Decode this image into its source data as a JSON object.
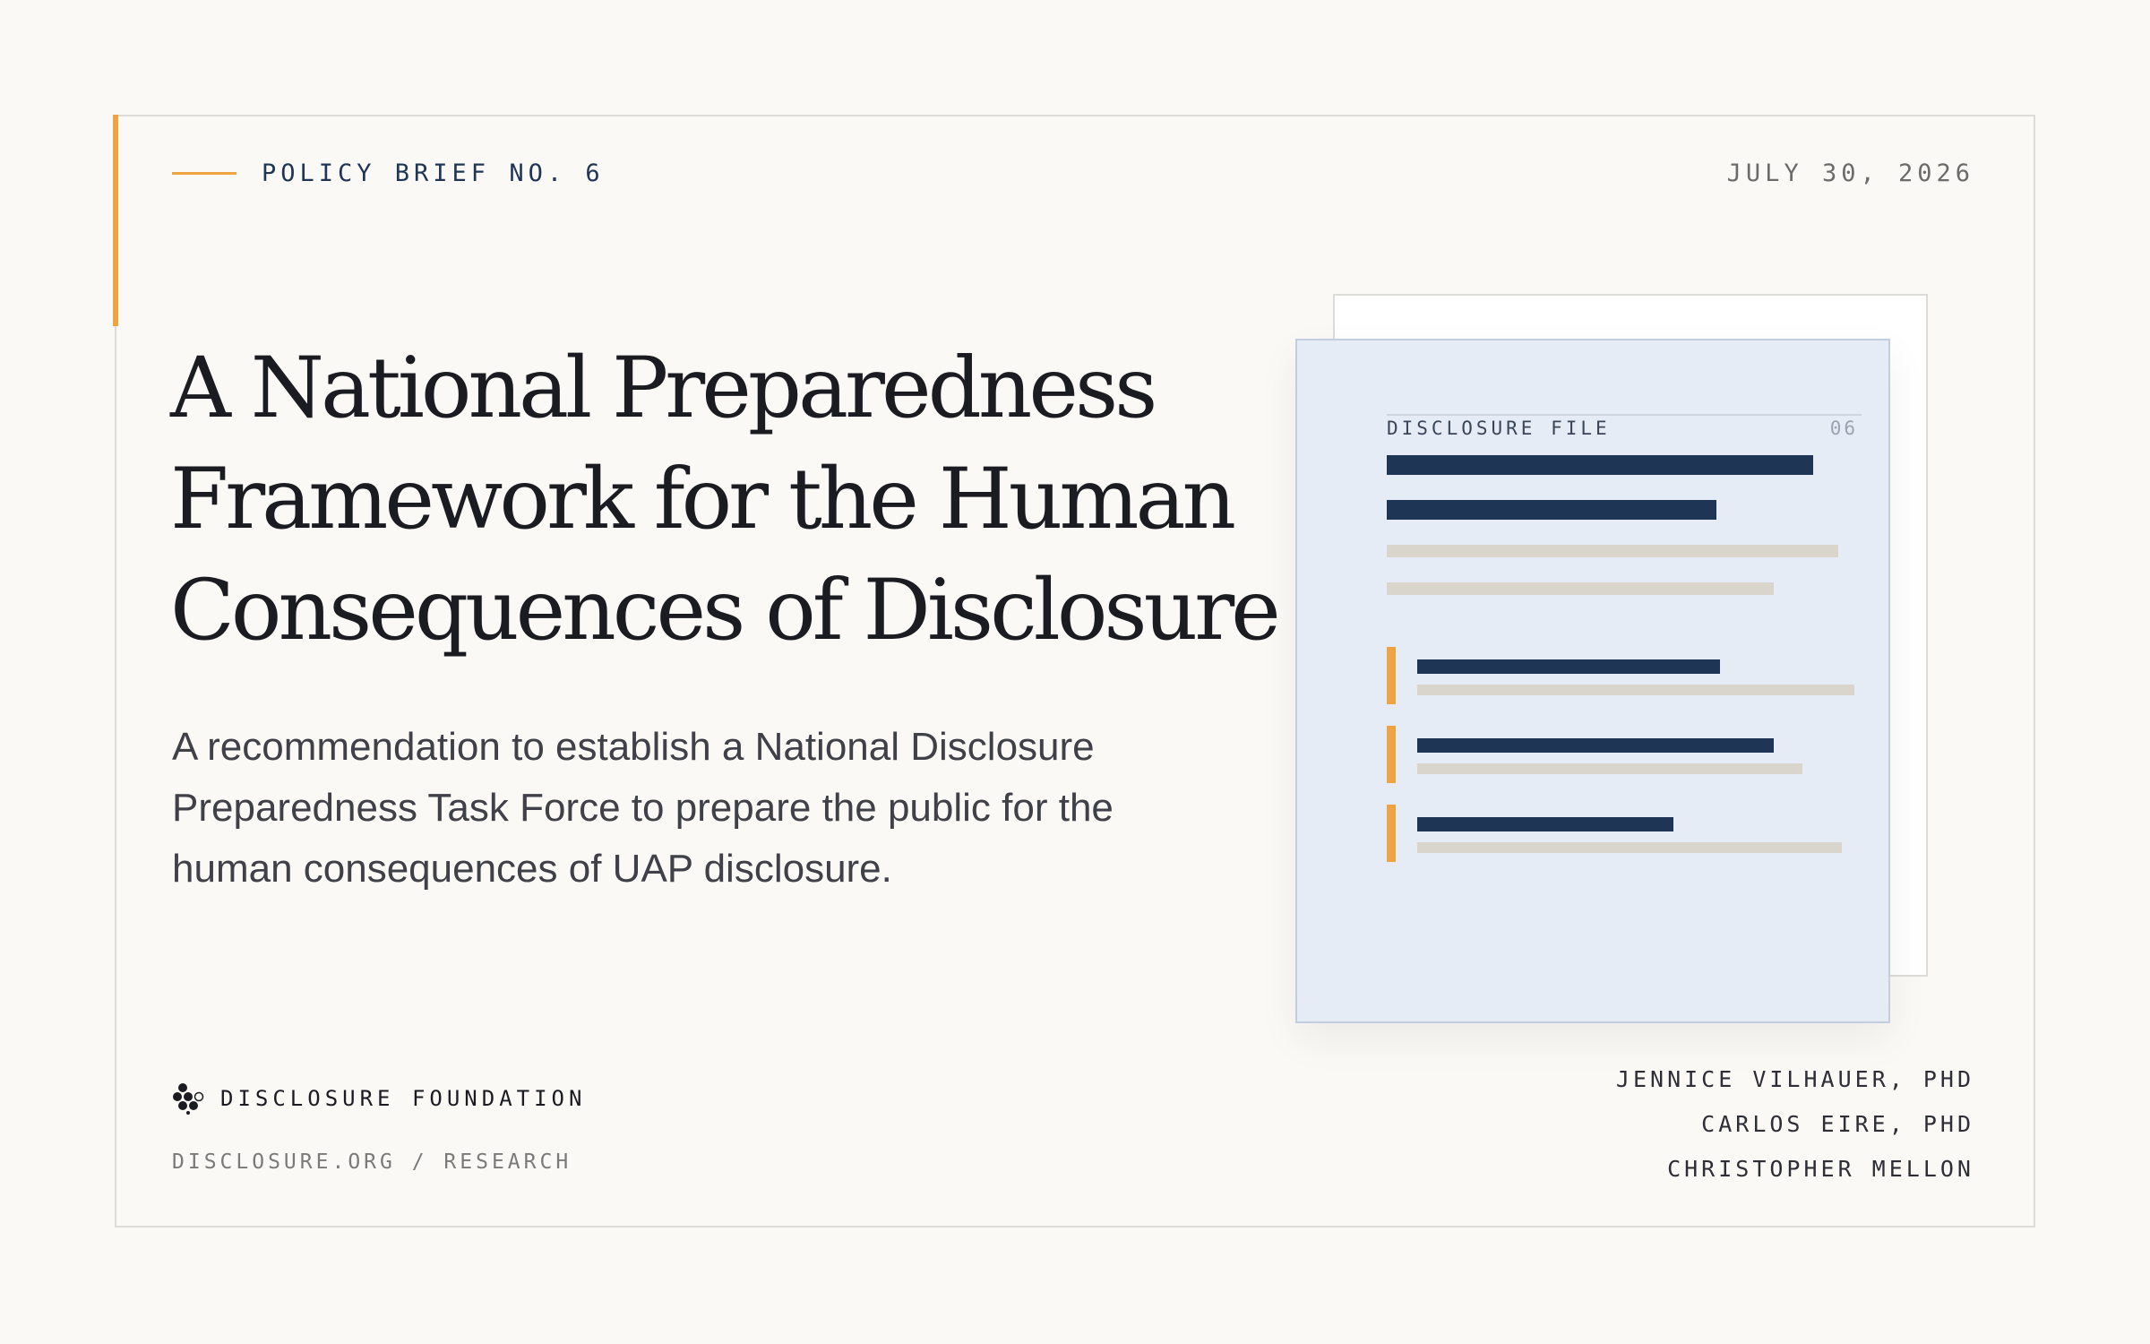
{
  "header": {
    "eyebrow": "POLICY BRIEF NO. 6",
    "date": "JULY 30, 2026"
  },
  "title": "A National Preparedness Framework for the Human Consequences of Disclosure",
  "subtitle": "A recommendation to establish a National Disclosure Preparedness Task Force to prepare the public for the human consequences of UAP disclosure.",
  "brand": {
    "name": "DISCLOSURE FOUNDATION",
    "url": "DISCLOSURE.ORG / RESEARCH",
    "logo_icon": "hexagon-cluster-icon"
  },
  "authors": [
    "JENNICE VILHAUER, PHD",
    "CARLOS EIRE, PHD",
    "CHRISTOPHER MELLON"
  ],
  "document_illustration": {
    "label": "DISCLOSURE FILE",
    "number": "06"
  },
  "colors": {
    "accent": "#efa444",
    "navy": "#1e3556",
    "background": "#faf9f5",
    "doc_fill": "#e6ecf5"
  }
}
